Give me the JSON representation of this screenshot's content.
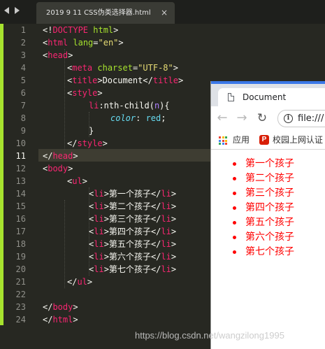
{
  "editor": {
    "tab_title": "2019 9 11 CSS伪类选择器.html",
    "close_glyph": "×",
    "line_numbers": [
      "1",
      "2",
      "3",
      "4",
      "5",
      "6",
      "7",
      "8",
      "9",
      "10",
      "11",
      "12",
      "13",
      "14",
      "15",
      "16",
      "17",
      "18",
      "19",
      "20",
      "21",
      "22",
      "23",
      "24"
    ],
    "current_line": "11",
    "accent_color": "#a6e22e",
    "code": {
      "l1_open": "<!",
      "l1_tag": "DOCTYPE",
      "l1_attr": " html",
      "l1_close": ">",
      "l2_open": "<",
      "l2_tag": "html",
      "l2_attr": " lang",
      "l2_eq": "=",
      "l2_val": "\"en\"",
      "l2_close": ">",
      "l3_open": "<",
      "l3_tag": "head",
      "l3_close": ">",
      "l4_open": "<",
      "l4_tag": "meta",
      "l4_attr": " charset",
      "l4_eq": "=",
      "l4_val": "\"UTF-8\"",
      "l4_close": ">",
      "l5_open": "<",
      "l5_tag": "title",
      "l5_mid": ">Document</",
      "l5_tag2": "title",
      "l5_close": ">",
      "l6_open": "<",
      "l6_tag": "style",
      "l6_close": ">",
      "l7_sel": "li",
      "l7_pseudo": ":nth-child(",
      "l7_param": "n",
      "l7_end": "){",
      "l8_prop": "color",
      "l8_colon": ": ",
      "l8_val": "red",
      "l8_semi": ";",
      "l9_brace": "}",
      "l10_open": "</",
      "l10_tag": "style",
      "l10_close": ">",
      "l11_open": "</",
      "l11_tag": "head",
      "l11_close": ">",
      "l12_open": "<",
      "l12_tag": "body",
      "l12_close": ">",
      "l13_open": "<",
      "l13_tag": "ul",
      "l13_close": ">",
      "li_open": "<",
      "li_tag": "li",
      "li_gt": ">",
      "li_close_open": "</",
      "li_close": ">",
      "li_texts": [
        "第一个孩子",
        "第二个孩子",
        "第三个孩子",
        "第四个孩子",
        "第五个孩子",
        "第六个孩子",
        "第七个孩子"
      ],
      "l21_open": "</",
      "l21_tag": "ul",
      "l21_close": ">",
      "l23_open": "</",
      "l23_tag": "body",
      "l23_close": ">",
      "l24_open": "</",
      "l24_tag": "html",
      "l24_close": ">"
    }
  },
  "browser": {
    "tab_title": "Document",
    "back_glyph": "←",
    "forward_glyph": "→",
    "reload_glyph": "↻",
    "info_glyph": "i",
    "url": "file:///",
    "bookmarks": [
      {
        "label": "应用",
        "icon": "apps-grid-icon"
      },
      {
        "label": "校园上网认证",
        "icon": "p-logo-icon",
        "icon_text": "P"
      }
    ],
    "list_items": [
      "第一个孩子",
      "第二个孩子",
      "第三个孩子",
      "第四个孩子",
      "第五个孩子",
      "第六个孩子",
      "第七个孩子"
    ],
    "list_color": "#ff0000"
  },
  "watermark": "https://blog.csdn.net/wangzilong1995"
}
